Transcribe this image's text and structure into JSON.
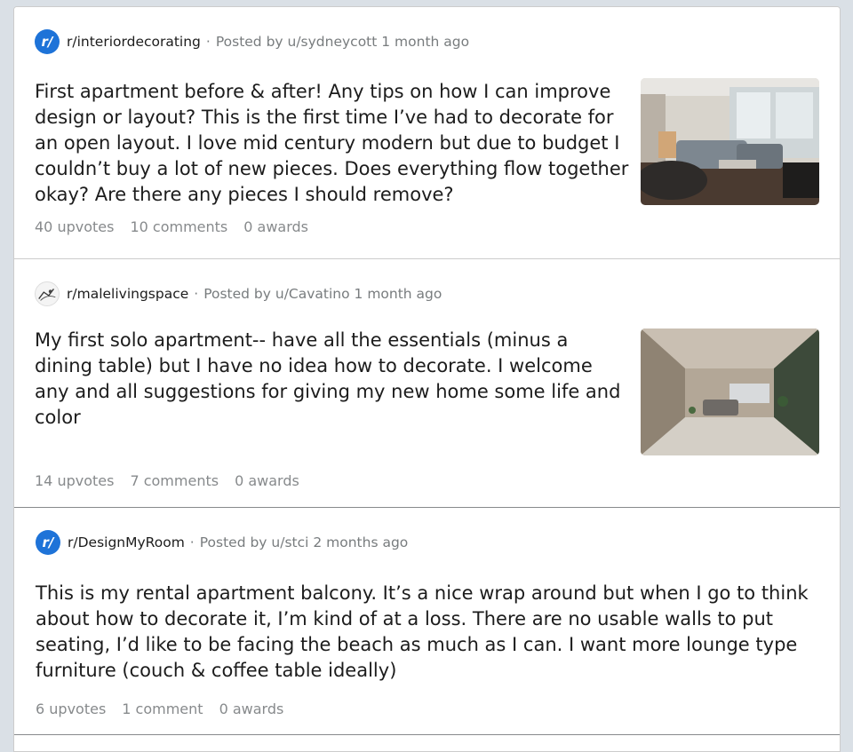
{
  "posts": [
    {
      "subreddit": "r/interiordecorating",
      "icon": "reddit-r-icon",
      "posted_by": "Posted by u/sydneycott 1 month ago",
      "title": "First apartment before & after! Any tips on how I can improve design or layout? This is the first time I’ve had to decorate for an open layout. I love mid century modern but due to budget I couldn’t buy a lot of new pieces. Does everything flow together okay? Are there any pieces I should remove?",
      "upvotes": "40 upvotes",
      "comments": "10 comments",
      "awards": "0 awards"
    },
    {
      "subreddit": "r/malelivingspace",
      "icon": "sketch-avatar-icon",
      "posted_by": "Posted by u/Cavatino 1 month ago",
      "title": "My first solo apartment-- have all the essentials (minus a dining table) but I have no idea how to decorate. I welcome any and all suggestions for giving my new home some life and color",
      "upvotes": "14 upvotes",
      "comments": "7 comments",
      "awards": "0 awards"
    },
    {
      "subreddit": "r/DesignMyRoom",
      "icon": "reddit-r-icon",
      "posted_by": "Posted by u/stci 2 months ago",
      "title": "This is my rental apartment balcony. It’s a nice wrap around but when I go to think about how to decorate it, I’m kind of at a loss. There are no usable walls to put seating, I’d like to be facing the beach as much as I can. I want more lounge type furniture (couch & coffee table ideally)",
      "upvotes": "6 upvotes",
      "comments": "1 comment",
      "awards": "0 awards"
    }
  ],
  "colors": {
    "page_bg": "#dae0e6",
    "card_bg": "#ffffff",
    "subreddit_icon": "#1e73d8",
    "meta_text": "#787c7e",
    "title_text": "#1c1c1c"
  }
}
